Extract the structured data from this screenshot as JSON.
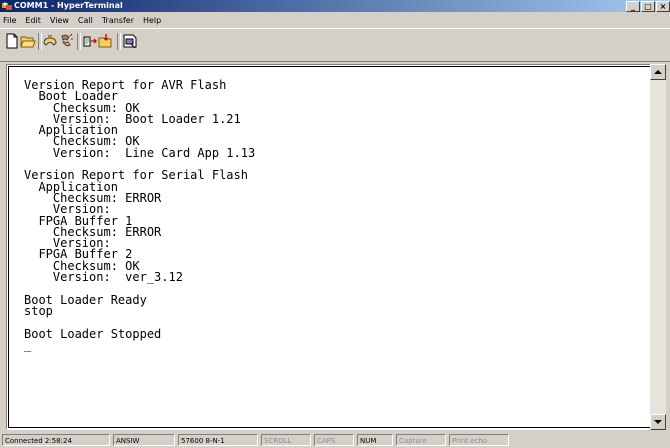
{
  "window": {
    "title": "COMM1 - HyperTerminal",
    "controls": {
      "minimize": "_",
      "maximize": "□",
      "close": "×"
    }
  },
  "menu": [
    "File",
    "Edit",
    "View",
    "Call",
    "Transfer",
    "Help"
  ],
  "toolbar": {
    "buttons": [
      {
        "icon": "new-connection-icon"
      },
      {
        "icon": "open-icon"
      },
      {
        "icon": "connect-icon"
      },
      {
        "icon": "disconnect-icon"
      },
      {
        "icon": "send-icon"
      },
      {
        "icon": "receive-icon"
      },
      {
        "icon": "properties-icon"
      }
    ]
  },
  "terminal": {
    "lines": [
      "Version Report for AVR Flash",
      "  Boot Loader",
      "    Checksum: OK",
      "    Version:  Boot Loader 1.21",
      "  Application",
      "    Checksum: OK",
      "    Version:  Line Card App 1.13",
      "",
      "Version Report for Serial Flash",
      "  Application",
      "    Checksum: ERROR",
      "    Version:",
      "  FPGA Buffer 1",
      "    Checksum: ERROR",
      "    Version:",
      "  FPGA Buffer 2",
      "    Checksum: OK",
      "    Version:  ver_3.12",
      "",
      "Boot Loader Ready",
      "stop",
      "",
      "Boot Loader Stopped",
      "_"
    ]
  },
  "status": {
    "connected": "Connected 2:58:24",
    "emulation": "ANSIW",
    "port_settings": "57600 8-N-1",
    "scroll": "SCROLL",
    "caps": "CAPS",
    "num": "NUM",
    "capture": "Capture",
    "print_echo": "Print echo"
  }
}
